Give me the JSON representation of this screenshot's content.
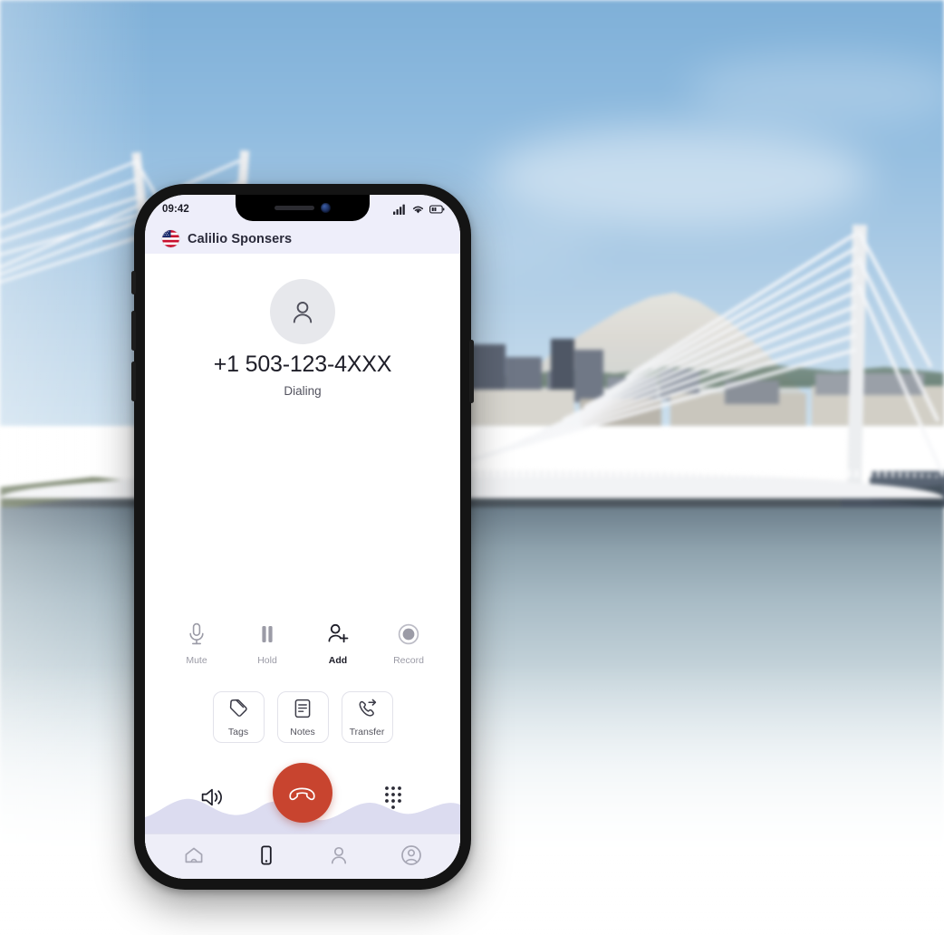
{
  "background": {
    "scene": "cable-stayed bridge over river with city skyline and snow-capped mountain",
    "sky_color": "#8fbbdf",
    "water_color": "#a9bcc6"
  },
  "phone": {
    "frame_color": "#141414",
    "statusbar": {
      "time": "09:42",
      "icons": [
        "cellular-signal-icon",
        "wifi-icon",
        "battery-icon"
      ]
    },
    "header": {
      "flag": "us-flag-icon",
      "title": "Calilio Sponsers",
      "bg_color": "#eeeefa"
    },
    "call": {
      "avatar_icon": "person-avatar-icon",
      "number": "+1 503-123-4XXX",
      "status": "Dialing",
      "primary_actions": [
        {
          "label": "Mute",
          "icon": "microphone-icon",
          "active": false
        },
        {
          "label": "Hold",
          "icon": "pause-icon",
          "active": false
        },
        {
          "label": "Add",
          "icon": "person-add-icon",
          "active": true
        },
        {
          "label": "Record",
          "icon": "record-icon",
          "active": false
        }
      ],
      "secondary_actions": [
        {
          "label": "Tags",
          "icon": "tag-icon"
        },
        {
          "label": "Notes",
          "icon": "note-icon"
        },
        {
          "label": "Transfer",
          "icon": "call-transfer-icon"
        }
      ],
      "bottom_controls": [
        {
          "name": "speaker",
          "icon": "speaker-icon"
        },
        {
          "name": "end-call",
          "icon": "end-call-icon",
          "color": "#c8442f"
        },
        {
          "name": "keypad",
          "icon": "dialpad-icon"
        }
      ],
      "wave_color": "#dcdcf0"
    },
    "bottom_nav": [
      {
        "name": "home",
        "icon": "home-icon",
        "active": false
      },
      {
        "name": "calls",
        "icon": "phone-device-icon",
        "active": true
      },
      {
        "name": "contacts",
        "icon": "person-icon",
        "active": false
      },
      {
        "name": "account",
        "icon": "account-circle-icon",
        "active": false
      }
    ]
  }
}
